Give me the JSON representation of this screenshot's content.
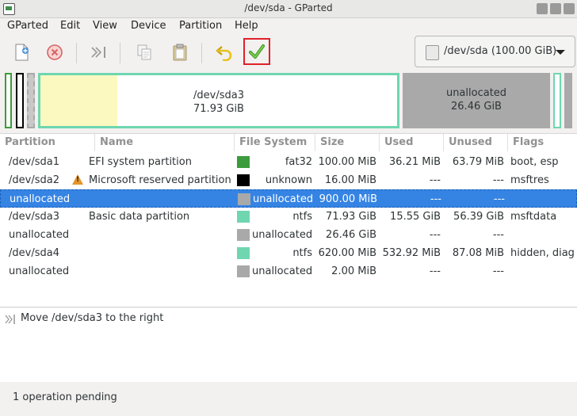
{
  "window": {
    "title": "/dev/sda - GParted"
  },
  "menu": [
    "GParted",
    "Edit",
    "View",
    "Device",
    "Partition",
    "Help"
  ],
  "toolbar": {
    "buttons": [
      "new-partition",
      "delete-partition",
      "resize-move",
      "copy",
      "paste",
      "undo",
      "apply"
    ]
  },
  "device_selector": {
    "label": "/dev/sda (100.00 GiB)"
  },
  "disk_map": {
    "main": {
      "name": "/dev/sda3",
      "size": "71.93 GiB",
      "used_fraction": 0.216
    },
    "unalloc": {
      "name": "unallocated",
      "size": "26.46 GiB"
    }
  },
  "table": {
    "headers": [
      "Partition",
      "Name",
      "File System",
      "Size",
      "Used",
      "Unused",
      "Flags"
    ],
    "rows": [
      {
        "partition": "/dev/sda1",
        "name": "EFI system partition",
        "fs": "fat32",
        "fs_color": "#3c9b3c",
        "size": "100.00 MiB",
        "used": "36.21 MiB",
        "unused": "63.79 MiB",
        "flags": "boot, esp",
        "warning": false,
        "selected": false
      },
      {
        "partition": "/dev/sda2",
        "name": "Microsoft reserved partition",
        "fs": "unknown",
        "fs_color": "#000000",
        "size": "16.00 MiB",
        "used": "---",
        "unused": "---",
        "flags": "msftres",
        "warning": true,
        "selected": false
      },
      {
        "partition": "unallocated",
        "name": "",
        "fs": "unallocated",
        "fs_color": "#a9a9a9",
        "size": "900.00 MiB",
        "used": "---",
        "unused": "---",
        "flags": "",
        "warning": false,
        "selected": true
      },
      {
        "partition": "/dev/sda3",
        "name": "Basic data partition",
        "fs": "ntfs",
        "fs_color": "#6fd6b0",
        "size": "71.93 GiB",
        "used": "15.55 GiB",
        "unused": "56.39 GiB",
        "flags": "msftdata",
        "warning": false,
        "selected": false
      },
      {
        "partition": "unallocated",
        "name": "",
        "fs": "unallocated",
        "fs_color": "#a9a9a9",
        "size": "26.46 GiB",
        "used": "---",
        "unused": "---",
        "flags": "",
        "warning": false,
        "selected": false
      },
      {
        "partition": "/dev/sda4",
        "name": "",
        "fs": "ntfs",
        "fs_color": "#6fd6b0",
        "size": "620.00 MiB",
        "used": "532.92 MiB",
        "unused": "87.08 MiB",
        "flags": "hidden, diag",
        "warning": false,
        "selected": false
      },
      {
        "partition": "unallocated",
        "name": "",
        "fs": "unallocated",
        "fs_color": "#a9a9a9",
        "size": "2.00 MiB",
        "used": "---",
        "unused": "---",
        "flags": "",
        "warning": false,
        "selected": false
      }
    ]
  },
  "operations": [
    "Move /dev/sda3 to the right"
  ],
  "status": "1 operation pending"
}
